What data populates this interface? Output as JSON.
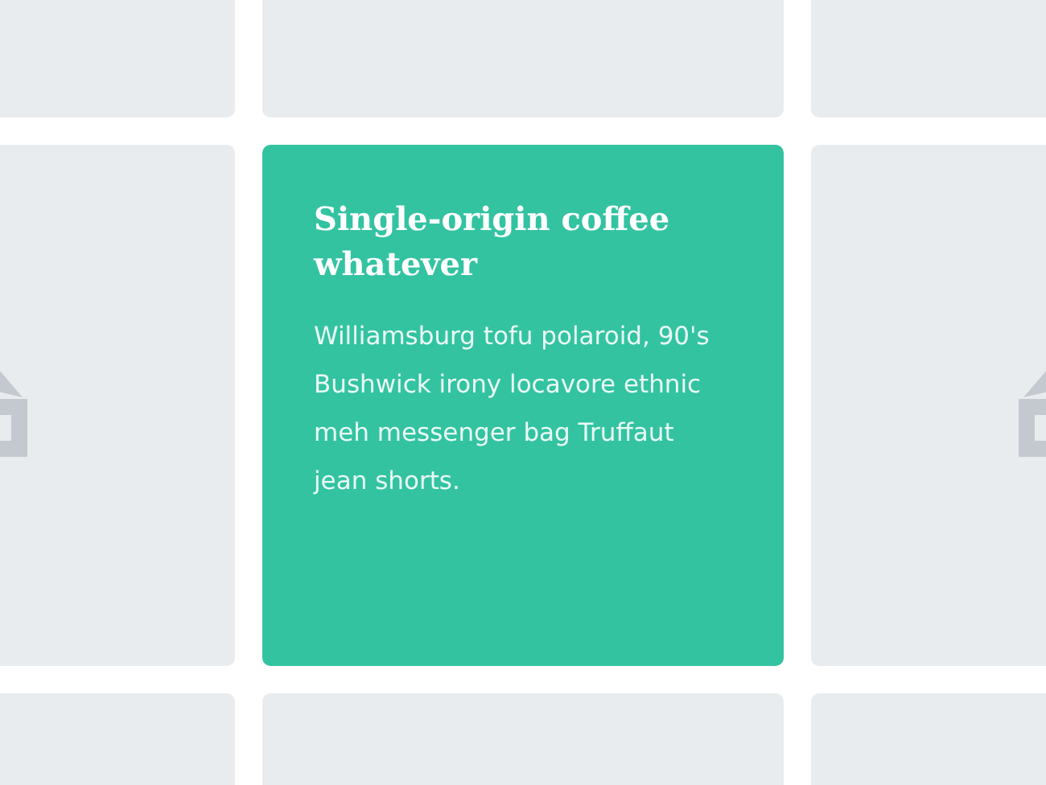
{
  "cards": [
    {
      "kind": "blank"
    },
    {
      "kind": "blank"
    },
    {
      "kind": "blank"
    },
    {
      "kind": "icon"
    },
    {
      "kind": "text",
      "title": "Single-origin coffee whatever",
      "body": "Williamsburg tofu polaroid, 90's Bushwick irony locavore ethnic meh messenger bag Truffaut jean shorts."
    },
    {
      "kind": "icon"
    },
    {
      "kind": "blank"
    },
    {
      "kind": "blank"
    },
    {
      "kind": "blank"
    }
  ]
}
